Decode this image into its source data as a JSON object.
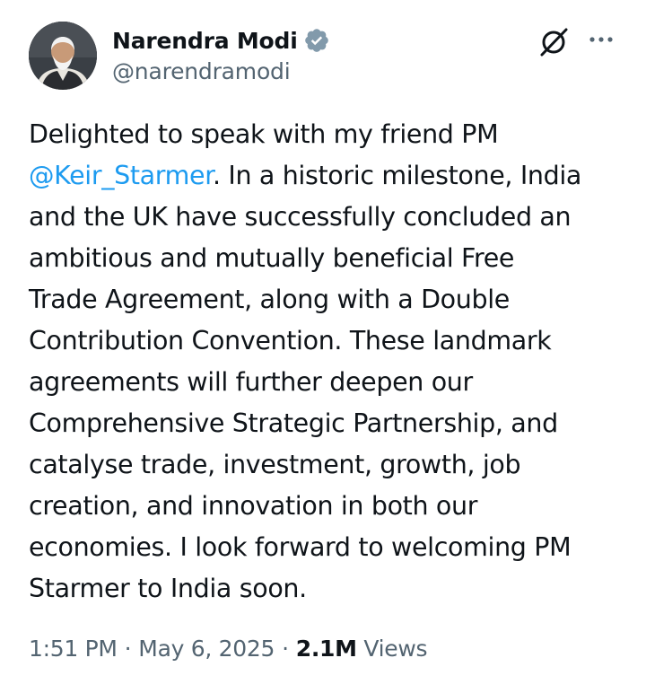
{
  "author": {
    "display_name": "Narendra Modi",
    "handle": "@narendramodi",
    "verified": true,
    "avatar_icon": "user-avatar"
  },
  "header_icons": {
    "grok": "grok-icon",
    "more": "more-options-icon"
  },
  "post": {
    "lines": [
      {
        "text": "Delighted to speak with my friend PM"
      },
      {
        "mention": "@Keir_Starmer",
        "text": ". In a historic milestone, India"
      },
      {
        "text": "and the UK have successfully concluded an"
      },
      {
        "text": "ambitious and mutually beneficial Free"
      },
      {
        "text": "Trade Agreement, along with a Double"
      },
      {
        "text": "Contribution Convention. These landmark"
      },
      {
        "text": "agreements will further deepen our"
      },
      {
        "text": "Comprehensive Strategic Partnership, and"
      },
      {
        "text": "catalyse trade, investment, growth, job"
      },
      {
        "text": "creation, and innovation in both our"
      },
      {
        "text": "economies. I look forward to welcoming PM"
      },
      {
        "text": "Starmer to India soon."
      }
    ]
  },
  "meta": {
    "time": "1:51 PM",
    "separator": "·",
    "date": "May 6, 2025",
    "views_count": "2.1M",
    "views_label": "Views"
  },
  "colors": {
    "text": "#0f1419",
    "secondary": "#536471",
    "link": "#1d9bf0",
    "verified_badge": "#829aab"
  }
}
